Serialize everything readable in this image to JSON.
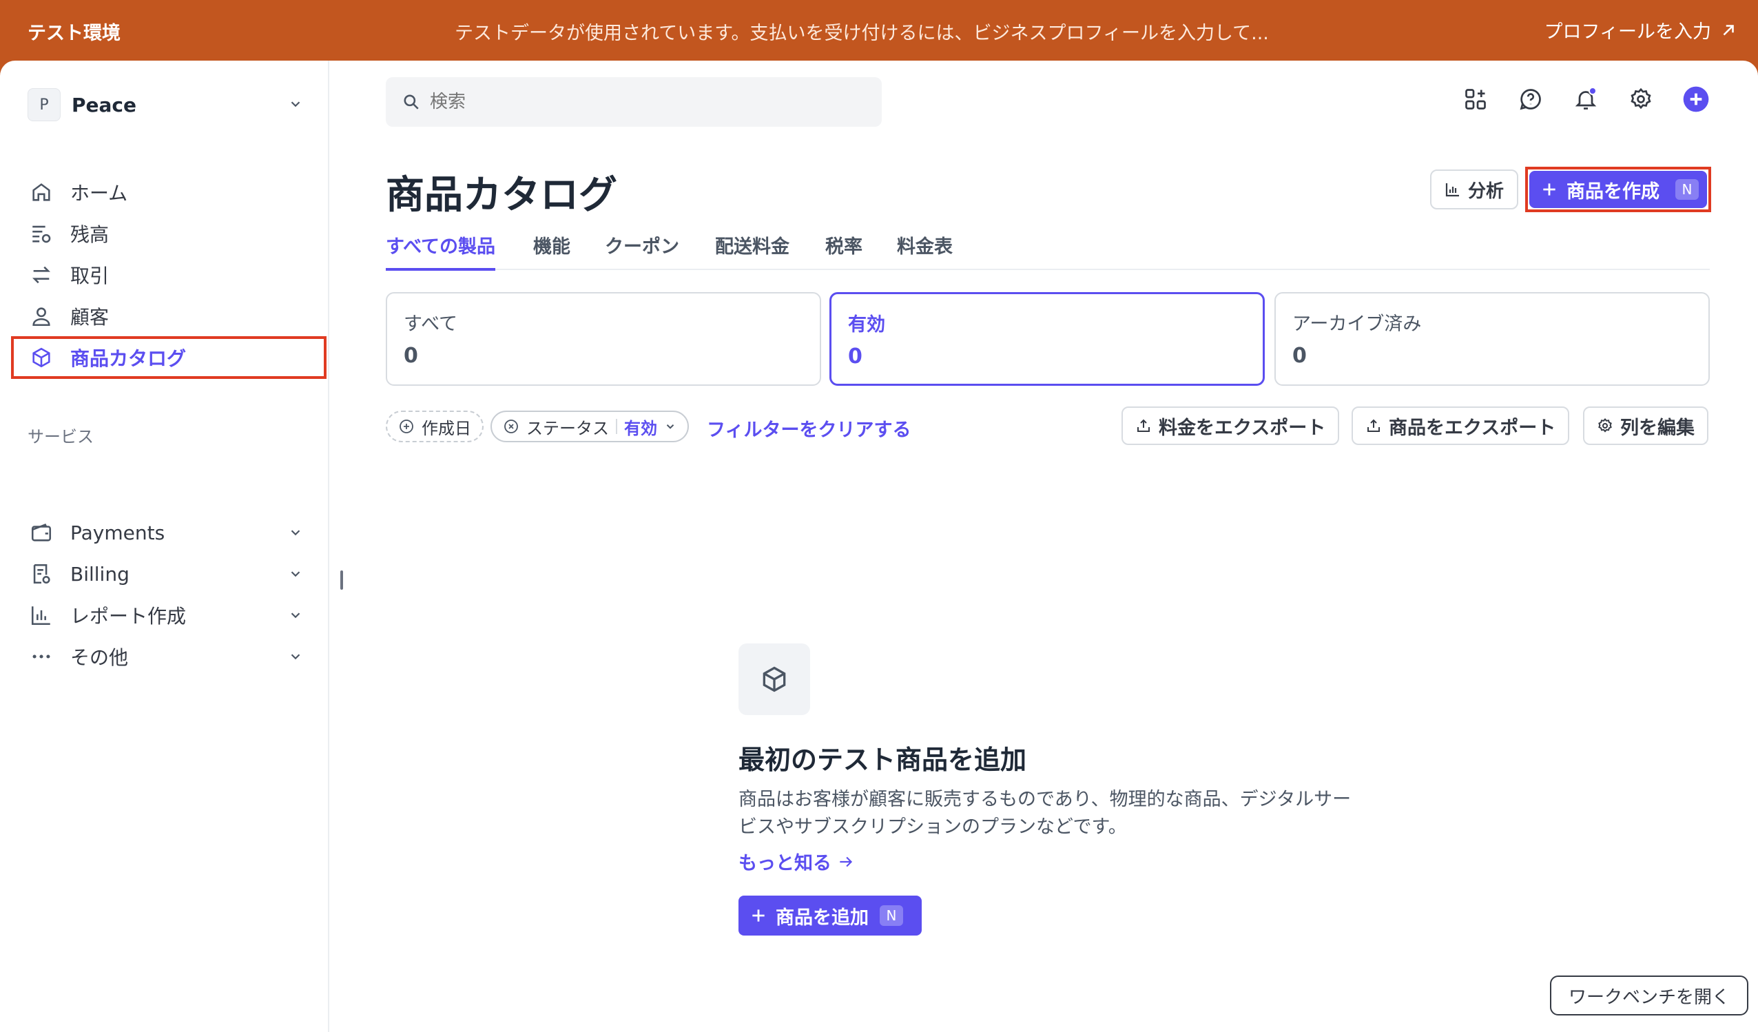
{
  "banner": {
    "env_label": "テスト環境",
    "message": "テストデータが使用されています。支払いを受け付けるには、ビジネスプロフィールを入力して...",
    "profile_link": "プロフィールを入力"
  },
  "account": {
    "initial": "P",
    "name": "Peace"
  },
  "sidebar": {
    "items": [
      {
        "label": "ホーム",
        "icon": "home-icon"
      },
      {
        "label": "残高",
        "icon": "balance-icon"
      },
      {
        "label": "取引",
        "icon": "transactions-icon"
      },
      {
        "label": "顧客",
        "icon": "customer-icon"
      },
      {
        "label": "商品カタログ",
        "icon": "box-icon",
        "active": true
      }
    ],
    "section_label": "サービス",
    "services": [
      {
        "label": "Payments",
        "icon": "wallet-icon"
      },
      {
        "label": "Billing",
        "icon": "billing-icon"
      },
      {
        "label": "レポート作成",
        "icon": "chart-icon"
      },
      {
        "label": "その他",
        "icon": "more-icon"
      }
    ]
  },
  "search": {
    "placeholder": "検索"
  },
  "page": {
    "title": "商品カタログ",
    "analytics_label": "分析",
    "create_label": "商品を作成",
    "create_shortcut": "N"
  },
  "tabs": [
    "すべての製品",
    "機能",
    "クーポン",
    "配送料金",
    "税率",
    "料金表"
  ],
  "status_cards": [
    {
      "label": "すべて",
      "count": "0"
    },
    {
      "label": "有効",
      "count": "0",
      "active": true
    },
    {
      "label": "アーカイブ済み",
      "count": "0"
    }
  ],
  "filters": {
    "created": "作成日",
    "status_label": "ステータス",
    "status_value": "有効",
    "clear": "フィルターをクリアする",
    "export_prices": "料金をエクスポート",
    "export_products": "商品をエクスポート",
    "edit_columns": "列を編集"
  },
  "empty_state": {
    "title": "最初のテスト商品を追加",
    "description": "商品はお客様が顧客に販売するものであり、物理的な商品、デジタルサービスやサブスクリプションのプランなどです。",
    "learn_more": "もっと知る",
    "add_label": "商品を追加",
    "add_shortcut": "N"
  },
  "workbench": "ワークベンチを開く",
  "colors": {
    "banner": "#c2561f",
    "accent": "#5b4ef0",
    "highlight": "#e03b22"
  }
}
